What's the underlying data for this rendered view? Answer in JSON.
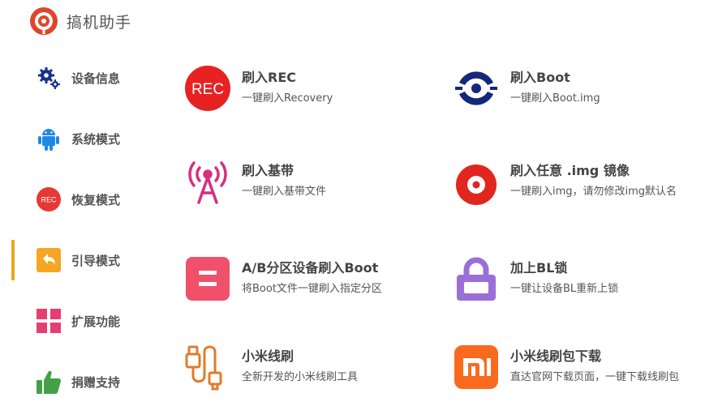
{
  "app": {
    "title": "搞机助手"
  },
  "sidebar": {
    "items": [
      {
        "label": "设备信息",
        "icon": "gears-icon",
        "color": "#1a2f8c"
      },
      {
        "label": "系统模式",
        "icon": "android-icon",
        "color": "#1e88e5"
      },
      {
        "label": "恢复模式",
        "icon": "rec-icon",
        "color": "#e53935"
      },
      {
        "label": "引导模式",
        "icon": "back-arrow-icon",
        "color": "#f5a623",
        "active": true
      },
      {
        "label": "扩展功能",
        "icon": "grid-icon",
        "color": "#e53f72"
      },
      {
        "label": "捐赠支持",
        "icon": "thumbs-up-icon",
        "color": "#43a047"
      }
    ],
    "active_color": "#e8a81d"
  },
  "main": {
    "cards": [
      {
        "title": "刷入REC",
        "desc": "一键刷入Recovery",
        "icon": "rec-icon",
        "icon_text": "REC",
        "color": "#e82222"
      },
      {
        "title": "刷入Boot",
        "desc": "一键刷入Boot.img",
        "icon": "boot-eye-icon",
        "color": "#14287a"
      },
      {
        "title": "刷入基带",
        "desc": "一键刷入基带文件",
        "icon": "antenna-icon",
        "color": "#d6307f"
      },
      {
        "title": "刷入任意 .img 镜像",
        "desc": "一键刷入img，请勿修改img默认名",
        "icon": "disc-icon",
        "color": "#e0261e"
      },
      {
        "title": "A/B分区设备刷入Boot",
        "desc": "将Boot文件一键刷入指定分区",
        "icon": "ab-partition-icon",
        "color": "#f0506a"
      },
      {
        "title": "加上BL锁",
        "desc": "一键让设备BL重新上锁",
        "icon": "lock-icon",
        "color": "#9b6fd8"
      },
      {
        "title": "小米线刷",
        "desc": "全新开发的小米线刷工具",
        "icon": "cable-icon",
        "color": "#e07c2c"
      },
      {
        "title": "小米线刷包下载",
        "desc": "直达官网下载页面，一键下载线刷包",
        "icon": "mi-logo-icon",
        "icon_text": "mi",
        "color": "#f96a1f"
      }
    ]
  }
}
